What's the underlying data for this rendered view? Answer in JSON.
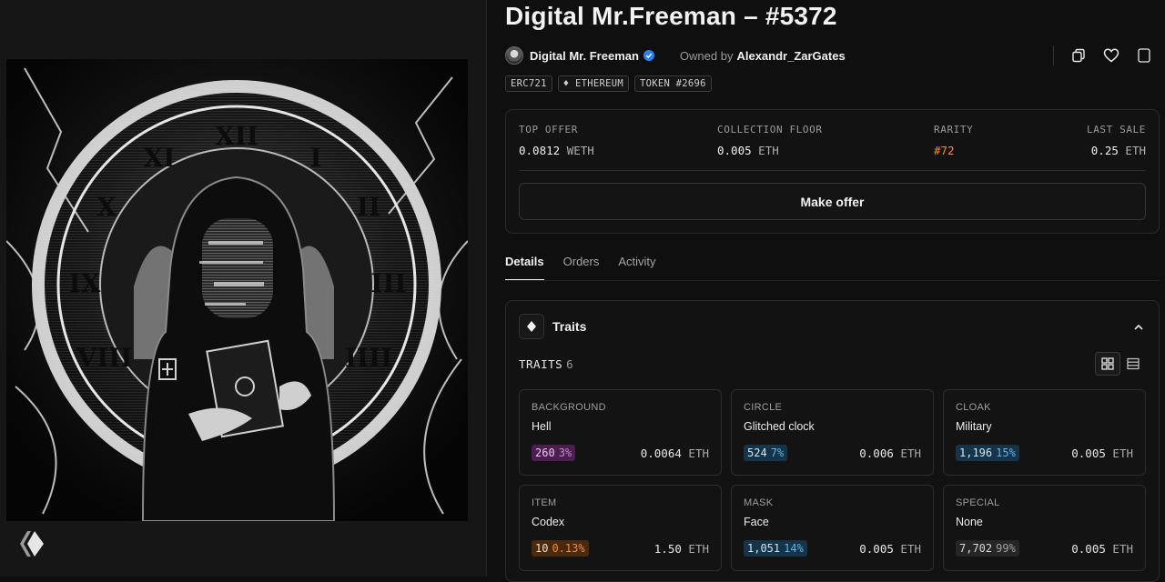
{
  "nft": {
    "title": "Digital Mr.Freeman – #5372",
    "creator": "Digital Mr. Freeman",
    "owned_by_label": "Owned by",
    "owner": "Alexandr_ZarGates"
  },
  "badges": [
    "ERC721",
    "♦ ETHEREUM",
    "TOKEN #2696"
  ],
  "stats": {
    "top_offer_label": "TOP OFFER",
    "top_offer_value": "0.0812",
    "top_offer_unit": "WETH",
    "floor_label": "COLLECTION FLOOR",
    "floor_value": "0.005",
    "floor_unit": "ETH",
    "rarity_label": "RARITY",
    "rarity_value": "#72",
    "last_sale_label": "LAST SALE",
    "last_sale_value": "0.25",
    "last_sale_unit": "ETH",
    "make_offer": "Make offer"
  },
  "tabs": [
    {
      "label": "Details"
    },
    {
      "label": "Orders"
    },
    {
      "label": "Activity"
    }
  ],
  "traits_section": {
    "title": "Traits",
    "count_label": "TRAITS",
    "count": "6"
  },
  "traits": [
    {
      "key": "BACKGROUND",
      "value": "Hell",
      "count": "260",
      "pct": "3%",
      "price": "0.0064",
      "unit": "ETH",
      "pill_bg": "#4a1f4f",
      "pill_fg": "#e9c4f0",
      "pct_fg": "#c58ad2"
    },
    {
      "key": "CIRCLE",
      "value": "Glitched clock",
      "count": "524",
      "pct": "7%",
      "price": "0.006",
      "unit": "ETH",
      "pill_bg": "#163449",
      "pill_fg": "#cfe6f5",
      "pct_fg": "#5fb3e6"
    },
    {
      "key": "CLOAK",
      "value": "Military",
      "count": "1,196",
      "pct": "15%",
      "price": "0.005",
      "unit": "ETH",
      "pill_bg": "#163449",
      "pill_fg": "#cfe6f5",
      "pct_fg": "#5fb3e6"
    },
    {
      "key": "ITEM",
      "value": "Codex",
      "count": "10",
      "pct": "0.13%",
      "price": "1.50",
      "unit": "ETH",
      "pill_bg": "#4a2a0c",
      "pill_fg": "#f5dcc0",
      "pct_fg": "#f08a3a"
    },
    {
      "key": "MASK",
      "value": "Face",
      "count": "1,051",
      "pct": "14%",
      "price": "0.005",
      "unit": "ETH",
      "pill_bg": "#163449",
      "pill_fg": "#cfe6f5",
      "pct_fg": "#5fb3e6"
    },
    {
      "key": "SPECIAL",
      "value": "None",
      "count": "7,702",
      "pct": "99%",
      "price": "0.005",
      "unit": "ETH",
      "pill_bg": "#262626",
      "pill_fg": "#d8d8d8",
      "pct_fg": "#a0a0a0"
    }
  ],
  "colors": {
    "background": "#0f0f0f",
    "rarity_accent": "#f0883e",
    "verified_blue": "#2f80ed"
  },
  "icons": {
    "copy": "copy-icon",
    "favorite": "heart-icon",
    "verified": "verified-badge-icon",
    "traits": "diamond-icon",
    "collapse": "chevron-up-icon",
    "grid_view": "grid-view-icon",
    "list_view": "list-view-icon",
    "brand": "hive-logo-icon"
  }
}
